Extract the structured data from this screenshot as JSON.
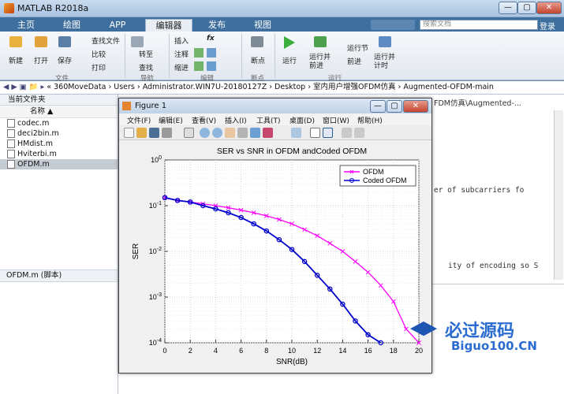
{
  "window": {
    "title": "MATLAB R2018a",
    "min": "—",
    "max": "▢",
    "close": "✕"
  },
  "tabs": [
    "主页",
    "绘图",
    "APP",
    "编辑器",
    "发布",
    "视图"
  ],
  "search_placeholder": "搜索文档",
  "login": "登录",
  "ribbon": {
    "file": {
      "new": "新建",
      "open": "打开",
      "save": "保存",
      "find_files": "查找文件",
      "compare": "比较",
      "print": "打印",
      "group": "文件"
    },
    "nav": {
      "goto": "转至",
      "find": "查找",
      "group": "导航"
    },
    "edit": {
      "insert": "插入",
      "comment": "注释",
      "indent": "缩进",
      "fx": "fx",
      "group": "编辑"
    },
    "breakpoint": {
      "label": "断点",
      "group": "断点"
    },
    "run": {
      "run": "运行",
      "run_advance": "运行并\n前进",
      "run_section": "运行节",
      "advance": "前进",
      "run_time": "运行并\n计时",
      "group": "运行"
    }
  },
  "address": "« 360MoveData › Users › Administrator.WIN7U-20180127Z › Desktop › 室内用户增强OFDM仿真 › Augmented-OFDM-main",
  "address_tail": "FDM仿真\\Augmented-...",
  "file_panel": {
    "title": "当前文件夹",
    "col": "名称 ▲",
    "files": [
      "codec.m",
      "deci2bin.m",
      "HMdist.m",
      "Hviterbi.m",
      "OFDM.m"
    ],
    "selected": "OFDM.m",
    "detail": "OFDM.m  (脚本)"
  },
  "editor_snippets": [
    "er of subcarriers fo",
    "ity of encoding so S"
  ],
  "figure": {
    "title": "Figure 1",
    "menu": [
      "文件(F)",
      "编辑(E)",
      "查看(V)",
      "插入(I)",
      "工具(T)",
      "桌面(D)",
      "窗口(W)",
      "帮助(H)"
    ]
  },
  "chart_data": {
    "type": "line",
    "title": "SER vs SNR in OFDM andCoded OFDM",
    "xlabel": "SNR(dB)",
    "ylabel": "SER",
    "xlim": [
      0,
      20
    ],
    "ylim": [
      0.0001,
      1
    ],
    "yscale": "log",
    "xticks": [
      0,
      2,
      4,
      6,
      8,
      10,
      12,
      14,
      16,
      18,
      20
    ],
    "yticks": [
      "10⁰",
      "10⁻¹",
      "10⁻²",
      "10⁻³",
      "10⁻⁴"
    ],
    "grid": true,
    "legend_position": "top-right",
    "series": [
      {
        "name": "OFDM",
        "color": "#ff00ff",
        "marker": "x",
        "x": [
          0,
          1,
          2,
          3,
          4,
          5,
          6,
          7,
          8,
          9,
          10,
          11,
          12,
          13,
          14,
          15,
          16,
          17,
          18,
          19,
          20
        ],
        "y": [
          0.15,
          0.13,
          0.12,
          0.11,
          0.1,
          0.09,
          0.08,
          0.07,
          0.06,
          0.05,
          0.04,
          0.03,
          0.022,
          0.015,
          0.01,
          0.006,
          0.0035,
          0.0018,
          0.0008,
          0.0002,
          0.0001
        ]
      },
      {
        "name": "Coded OFDM",
        "color": "#0000cc",
        "marker": "o",
        "x": [
          0,
          1,
          2,
          3,
          4,
          5,
          6,
          7,
          8,
          9,
          10,
          11,
          12,
          13,
          14,
          15,
          16,
          17
        ],
        "y": [
          0.15,
          0.13,
          0.12,
          0.1,
          0.085,
          0.07,
          0.055,
          0.04,
          0.028,
          0.018,
          0.011,
          0.006,
          0.003,
          0.0015,
          0.0007,
          0.0003,
          0.00015,
          0.0001
        ]
      }
    ]
  },
  "watermark": {
    "line1": "必过源码",
    "line2": "Biguo100.CN"
  }
}
